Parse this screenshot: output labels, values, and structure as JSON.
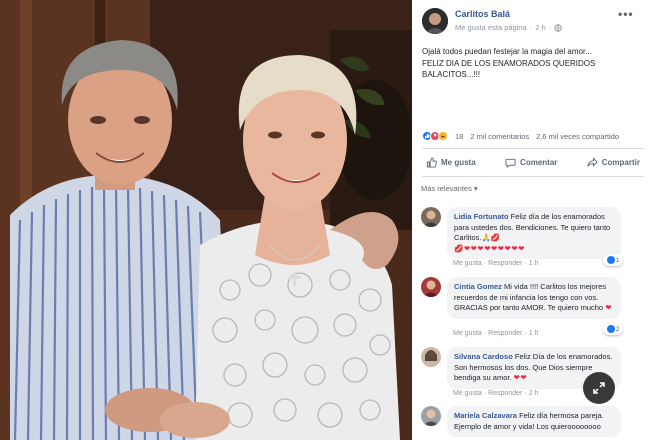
{
  "post": {
    "author": "Carlitos Balá",
    "liked_page": "Me gusta esta página",
    "time": "2 h",
    "text_line1": "Ojalá todos puedan festejar la magia del amor...",
    "text_line2": "FELIZ DIA DE LOS ENAMORADOS QUERIDOS BALACITOS...!!!"
  },
  "stats": {
    "reaction_count": "18",
    "comments": "2 mil comentarios",
    "shares": "2,6 mil veces compartido",
    "reaction_icons": [
      "like-icon",
      "love-icon",
      "haha-icon"
    ]
  },
  "actions": {
    "like": "Me gusta",
    "comment": "Comentar",
    "share": "Compartir"
  },
  "filter": {
    "label": "Más relevantes"
  },
  "comments": [
    {
      "name": "Lidia Fortunato",
      "text": "Feliz día de los enamorados para ustedes dos. Bendiciones. Te quiero tanto Carlitos.🙏💋",
      "emoji_line": "💋❤❤❤❤❤❤❤❤❤",
      "like": "Me gusta",
      "reply": "Responder",
      "time": "1 h",
      "reactions": "1"
    },
    {
      "name": "Cintia Gomez",
      "text": "Mi vida !!!! Carlitos los mejores recuerdos de mi infancia los tengo con vos. GRACIAS por tanto AMOR. Te quiero mucho",
      "heart": "❤",
      "like": "Me gusta",
      "reply": "Responder",
      "time": "1 h",
      "reactions": "2"
    },
    {
      "name": "Silvana Cardoso",
      "text": "Feliz Día de los enamorados. Son hermosos los dos. Que Dios siempre bendiga su amor.",
      "heart": "❤❤",
      "like": "Me gusta",
      "reply": "Responder",
      "time": "2 h"
    },
    {
      "name": "Mariela Calzavara",
      "text": "Feliz día hermosa pareja. Ejemplo de amor y vida! Los quieroooooooo"
    }
  ],
  "colors": {
    "link_blue": "#385898",
    "like_blue": "#1877f2",
    "bubble_gray": "#f2f3f5",
    "meta_gray": "#90949c"
  }
}
